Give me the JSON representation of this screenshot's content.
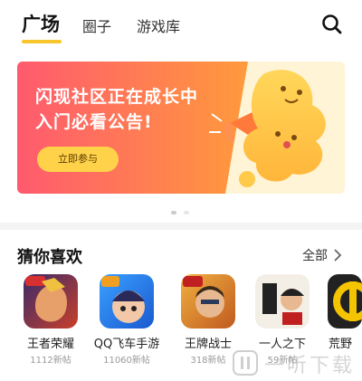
{
  "tabs": [
    {
      "label": "广场",
      "active": true
    },
    {
      "label": "圈子",
      "active": false
    },
    {
      "label": "游戏库",
      "active": false
    }
  ],
  "search": {
    "icon": "search-icon"
  },
  "banner": {
    "title_line1": "闪现社区正在成长中",
    "title_line2": "入门必看公告!",
    "button_label": "立即参与",
    "colors": {
      "gradient_start": "#ff5a6e",
      "gradient_end": "#ff9a3c",
      "mascot": "#ffc94a"
    }
  },
  "carousel": {
    "page_count": 2,
    "active_index": 0
  },
  "section": {
    "title": "猜你喜欢",
    "all_label": "全部"
  },
  "games": [
    {
      "name": "王者荣耀",
      "posts": "1112新帖"
    },
    {
      "name": "QQ飞车手游",
      "posts": "11060新帖"
    },
    {
      "name": "王牌战士",
      "posts": "318新帖"
    },
    {
      "name": "一人之下",
      "posts": "59新帖"
    },
    {
      "name": "荒野",
      "posts": ""
    }
  ],
  "watermark": {
    "text": "一听下载"
  },
  "accent_color": "#f7c62b"
}
